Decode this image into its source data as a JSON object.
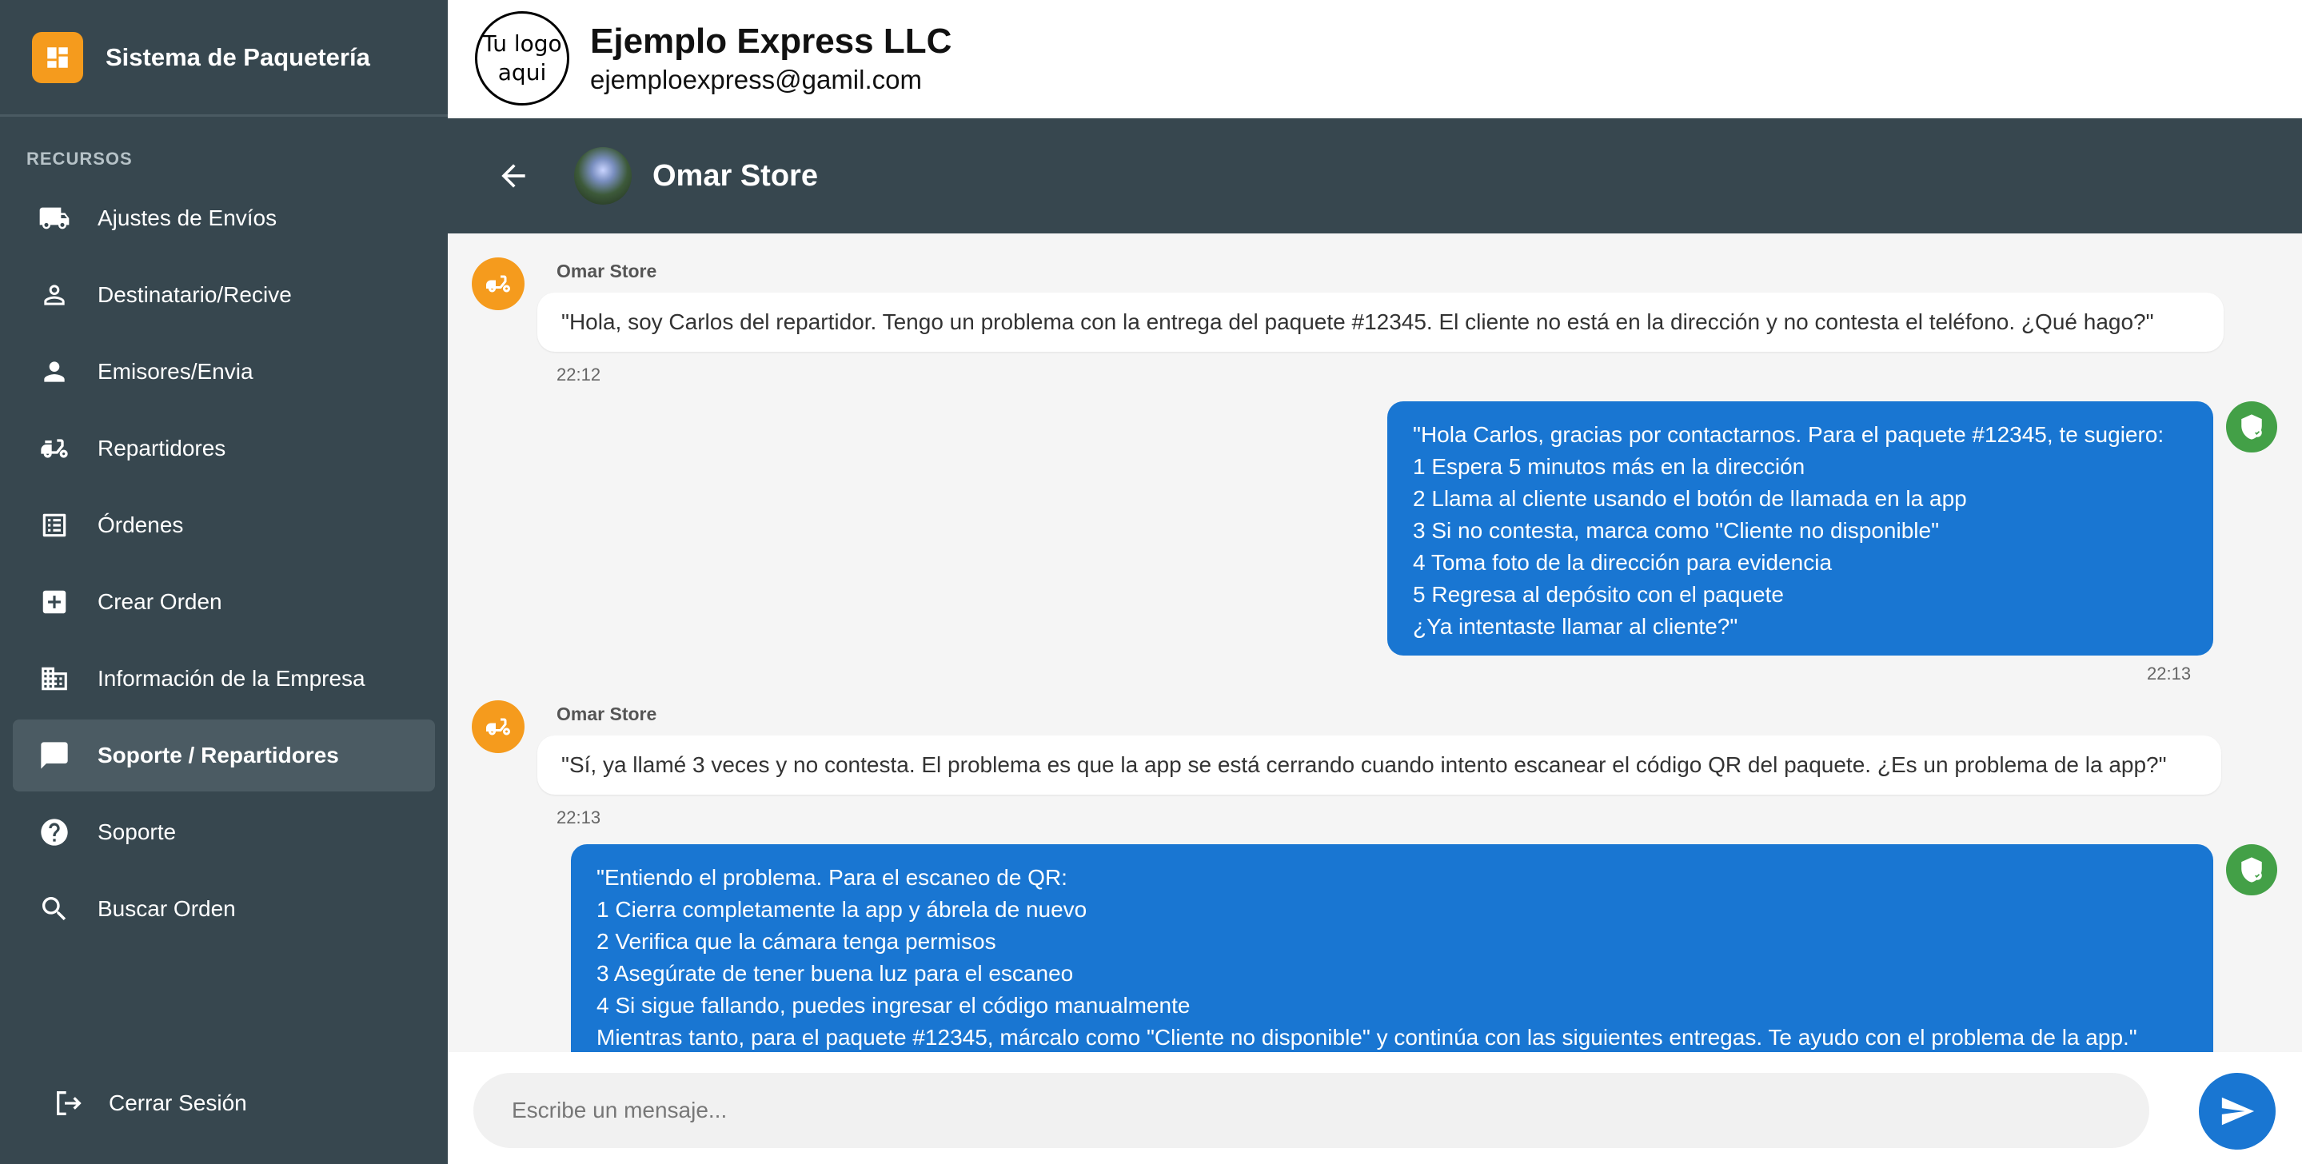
{
  "sidebar": {
    "brand_title": "Sistema de Paquetería",
    "section_label": "RECURSOS",
    "items": [
      {
        "label": "Ajustes de Envíos",
        "icon": "truck-icon"
      },
      {
        "label": "Destinatario/Recive",
        "icon": "person-outline-icon"
      },
      {
        "label": "Emisores/Envia",
        "icon": "person-icon"
      },
      {
        "label": "Repartidores",
        "icon": "delivery-scooter-icon"
      },
      {
        "label": "Órdenes",
        "icon": "list-icon"
      },
      {
        "label": "Crear Orden",
        "icon": "add-box-icon"
      },
      {
        "label": "Información de la Empresa",
        "icon": "building-icon"
      },
      {
        "label": "Soporte / Repartidores",
        "icon": "chat-icon",
        "active": true
      },
      {
        "label": "Soporte",
        "icon": "help-circle-icon"
      },
      {
        "label": "Buscar Orden",
        "icon": "search-icon"
      }
    ],
    "logout_label": "Cerrar Sesión"
  },
  "header": {
    "logo_text_line1": "Tu logo",
    "logo_text_line2": "aqui",
    "company_name": "Ejemplo Express LLC",
    "company_email": "ejemploexpress@gamil.com"
  },
  "chat": {
    "contact_name": "Omar Store",
    "messages": [
      {
        "direction": "in",
        "sender": "Omar Store",
        "text": "\"Hola, soy Carlos del repartidor. Tengo un problema con la entrega del paquete #12345. El cliente no está en la dirección y no contesta el teléfono. ¿Qué hago?\"",
        "time": "22:12"
      },
      {
        "direction": "out",
        "lines": [
          "\"Hola Carlos, gracias por contactarnos. Para el paquete #12345, te sugiero:",
          "1 Espera 5 minutos más en la dirección",
          "2 Llama al cliente usando el botón de llamada en la app",
          "3 Si no contesta, marca como \"Cliente no disponible\"",
          "4 Toma foto de la dirección para evidencia",
          "5 Regresa al depósito con el paquete",
          "¿Ya intentaste llamar al cliente?\""
        ],
        "time": "22:13"
      },
      {
        "direction": "in",
        "sender": "Omar Store",
        "text": "\"Sí, ya llamé 3 veces y no contesta. El problema es que la app se está cerrando cuando intento escanear el código QR del paquete. ¿Es un problema de la app?\"",
        "time": "22:13"
      },
      {
        "direction": "out",
        "lines": [
          "\"Entiendo el problema. Para el escaneo de QR:",
          "1 Cierra completamente la app y ábrela de nuevo",
          "2 Verifica que la cámara tenga permisos",
          "3 Asegúrate de tener buena luz para el escaneo",
          "4 Si sigue fallando, puedes ingresar el código manualmente",
          "Mientras tanto, para el paquete #12345, márcalo como \"Cliente no disponible\" y continúa con las siguientes entregas. Te ayudo con el problema de la app.\""
        ]
      }
    ],
    "input_placeholder": "Escribe un mensaje..."
  },
  "colors": {
    "sidebar_bg": "#37474f",
    "accent_orange": "#f59b1d",
    "bubble_blue": "#1976d2",
    "agent_green": "#43a047"
  }
}
